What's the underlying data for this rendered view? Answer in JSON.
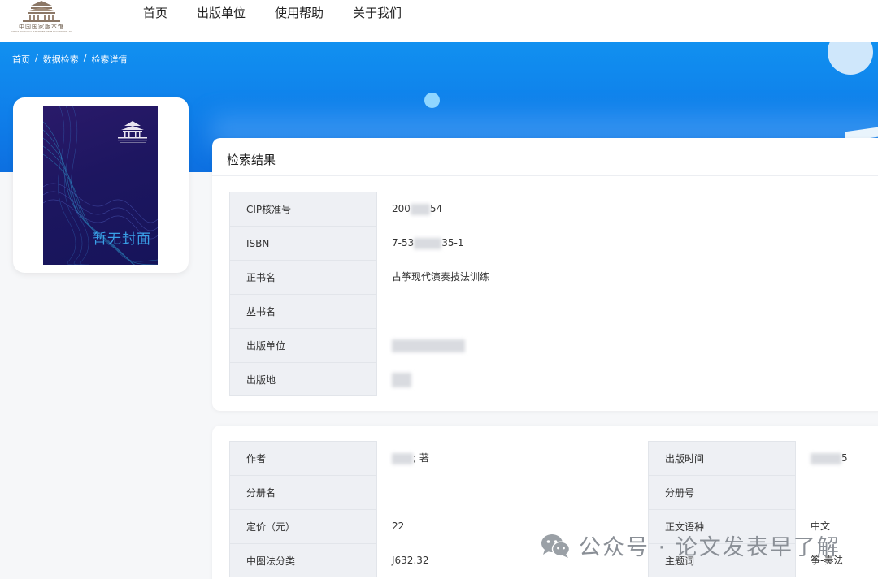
{
  "header": {
    "logo_text": "中国国家版本馆",
    "logo_subtext": "CHINA NATIONAL ARCHIVES OF PUBLICATIONS AND CULTURE",
    "nav": [
      "首页",
      "出版单位",
      "使用帮助",
      "关于我们"
    ]
  },
  "breadcrumb": [
    "首页",
    "数据检索",
    "检索详情"
  ],
  "breadcrumb_separator": "/",
  "cover": {
    "placeholder_text": "暂无封面"
  },
  "result": {
    "title": "检索结果",
    "rows": [
      {
        "label": "CIP核准号",
        "value_start": "200",
        "value_end": "54"
      },
      {
        "label": "ISBN",
        "value_start": "7-53",
        "value_end": "35-1"
      },
      {
        "label": "正书名",
        "value_start": "古筝现代演奏技法训练",
        "value_end": ""
      },
      {
        "label": "丛书名",
        "value_start": "",
        "value_end": ""
      },
      {
        "label": "出版单位",
        "value_start": "",
        "value_end": ""
      },
      {
        "label": "出版地",
        "value_start": "",
        "value_end": ""
      }
    ]
  },
  "details": {
    "left": [
      {
        "label": "作者",
        "value_start": "",
        "value_end": "",
        "value_suffix": "; 著"
      },
      {
        "label": "分册名",
        "value_start": "",
        "value_end": ""
      },
      {
        "label": "定价（元）",
        "value_start": "22",
        "value_end": ""
      },
      {
        "label": "中图法分类",
        "value_start": "J632.32",
        "value_end": ""
      }
    ],
    "right": [
      {
        "label": "出版时间",
        "value_start": "",
        "value_end": "5"
      },
      {
        "label": "分册号",
        "value_start": "",
        "value_end": ""
      },
      {
        "label": "正文语种",
        "value_start": "中文",
        "value_end": ""
      },
      {
        "label": "主题词",
        "value_start": "筝-奏法",
        "value_end": ""
      }
    ]
  },
  "watermark": {
    "text": "公众号 · 论文发表早了解",
    "icon": "wechat-icon"
  }
}
